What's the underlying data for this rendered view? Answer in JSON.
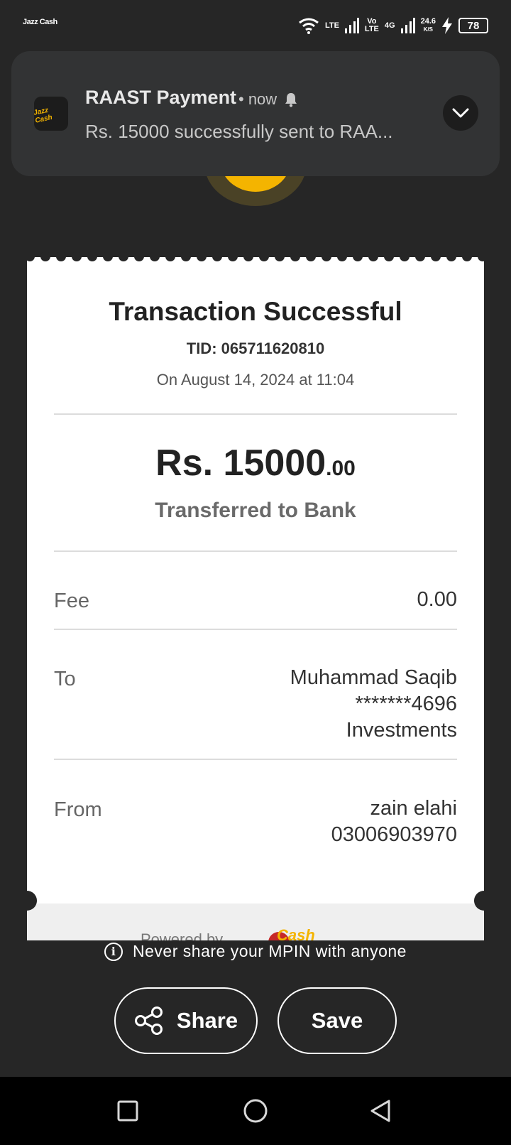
{
  "status_bar": {
    "app_logo": "Jazz Cash",
    "net1": "LTE",
    "net2_top": "Vo",
    "net2_bottom": "LTE",
    "net3": "4G",
    "speed_value": "24.6",
    "speed_unit": "K/S",
    "battery": "78"
  },
  "notification": {
    "app_icon_label": "Jazz Cash",
    "title": "RAAST Payment",
    "time": "• now",
    "text": "Rs. 15000 successfully sent to RAA..."
  },
  "receipt": {
    "title": "Transaction Successful",
    "tid": "TID: 065711620810",
    "datetime": "On August 14, 2024 at 11:04",
    "amount_main": "Rs. 15000",
    "amount_decimal": ".00",
    "transfer_type": "Transferred to Bank",
    "fee_label": "Fee",
    "fee_value": "0.00",
    "to_label": "To",
    "to_name": "Muhammad Saqib",
    "to_account": "*******4696",
    "to_bank": "Investments",
    "from_label": "From",
    "from_name": "zain elahi",
    "from_number": "03006903970",
    "powered_by": "Powered by",
    "brand": "Cash"
  },
  "hint": "Never share your MPIN with anyone",
  "actions": {
    "share": "Share",
    "save": "Save"
  },
  "colors": {
    "background": "#262626",
    "accent_yellow": "#f4b400",
    "card": "#ffffff",
    "notification_bg": "#323334"
  }
}
